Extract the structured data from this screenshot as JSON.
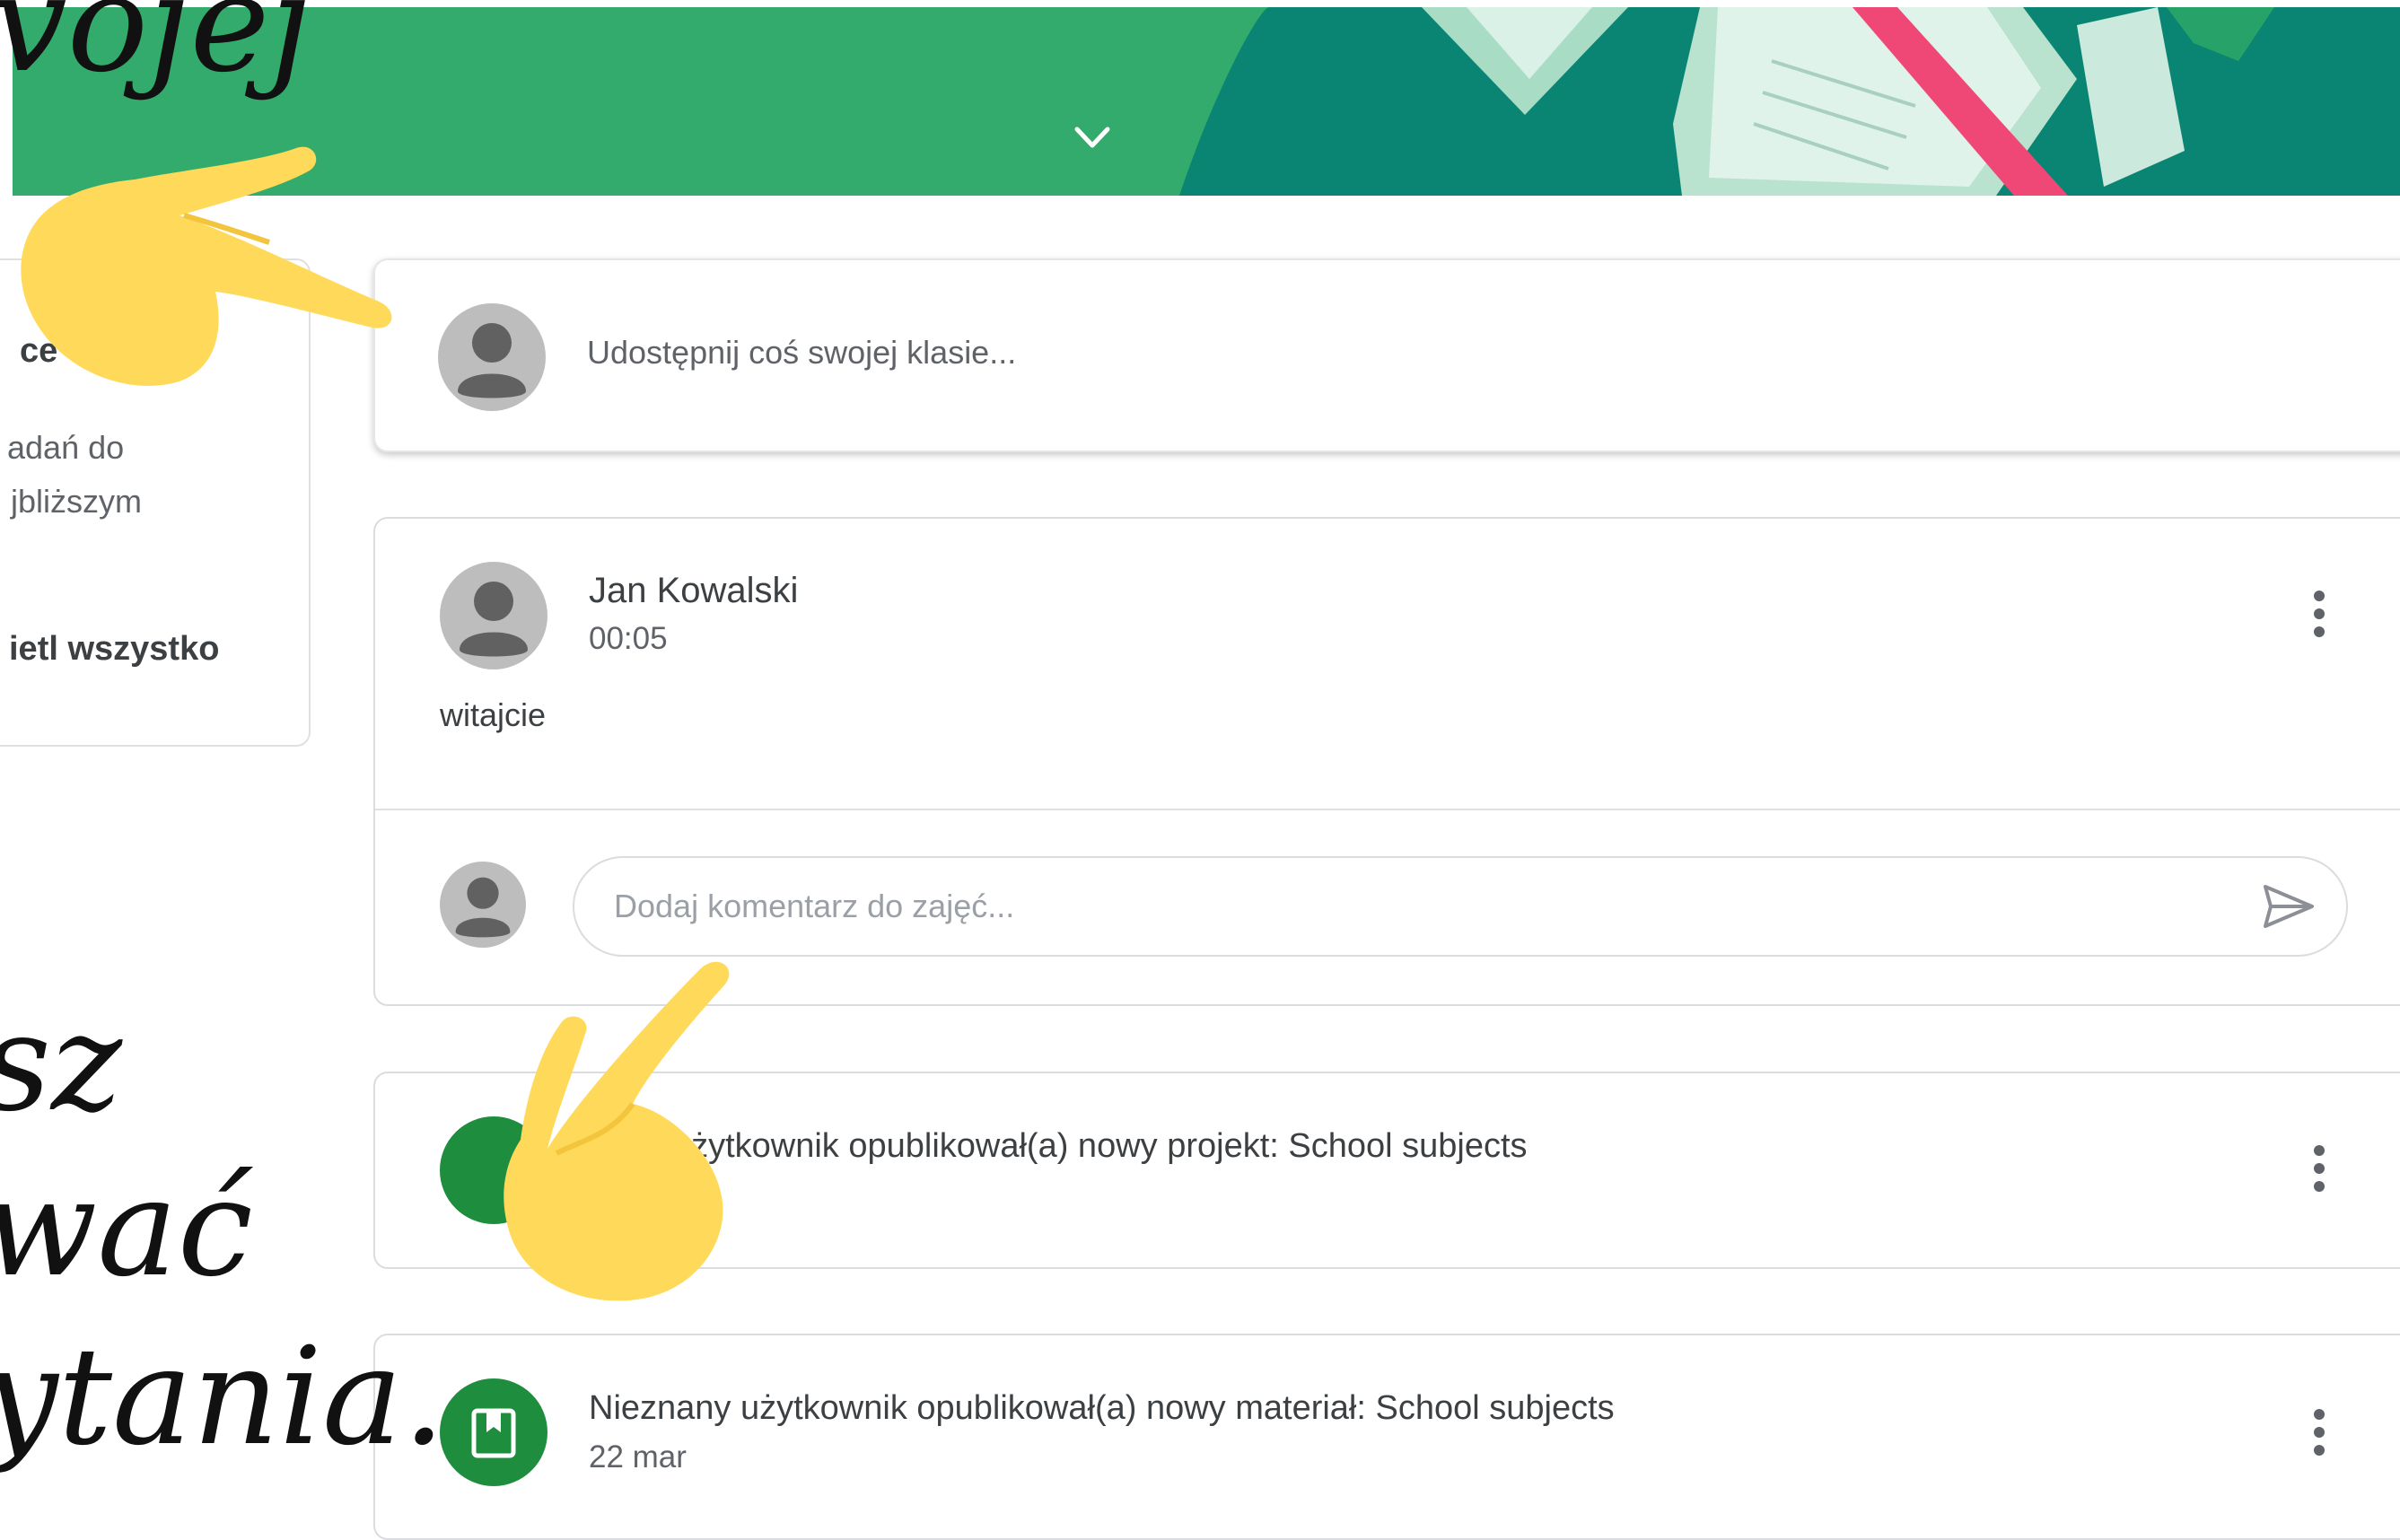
{
  "header": {
    "banner_color": "#33ab6c",
    "expand_icon": "chevron-down-icon"
  },
  "upcoming": {
    "title": "ce",
    "line1": "adań do",
    "line2": "jbliższym",
    "view_all": "ietl wszystko"
  },
  "share": {
    "prompt": "Udostępnij coś swojej klasie..."
  },
  "post": {
    "author": "Jan Kowalski",
    "time": "00:05",
    "body": "witajcie",
    "comment_placeholder": "Dodaj komentarz do zajęć...",
    "send_icon": "send-icon",
    "more_icon": "more-vert-icon"
  },
  "stream": [
    {
      "title": "nany użytkownik opublikował(a) nowy projekt: School subjects",
      "icon": "assignment-icon"
    },
    {
      "title": "Nieznany użytkownik opublikował(a) nowy materiał: School subjects",
      "date": "22 mar",
      "icon": "book-icon"
    }
  ],
  "handwriting": {
    "top": "vojej",
    "line1": "sz",
    "line2": "wać",
    "line3": "ytania."
  },
  "colors": {
    "accent": "#1e8e3e",
    "hand": "#ffd95a"
  }
}
